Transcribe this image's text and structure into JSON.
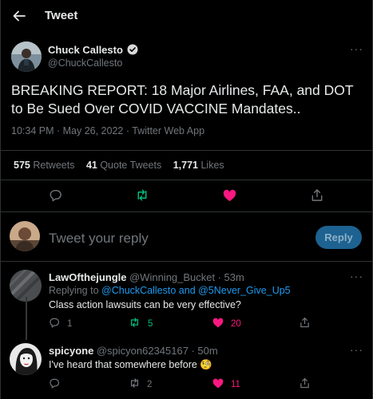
{
  "header": {
    "title": "Tweet"
  },
  "tweet": {
    "author_name": "Chuck Callesto",
    "author_handle": "@ChuckCallesto",
    "text": "BREAKING REPORT: 18 Major Airlines, FAA, and DOT to Be Sued Over COVID VACCINE Mandates..",
    "timestamp": "10:34 PM · May 26, 2022 · Twitter Web App",
    "stats": {
      "retweets_count": "575",
      "retweets_label": "Retweets",
      "quotes_count": "41",
      "quotes_label": "Quote Tweets",
      "likes_count": "1,771",
      "likes_label": "Likes"
    }
  },
  "composer": {
    "placeholder": "Tweet your reply",
    "button_label": "Reply"
  },
  "replies": [
    {
      "name": "LawOfthejungle",
      "handle": "@Winning_Bucket",
      "time": "· 53m",
      "replying_prefix": "Replying to",
      "replying_to": "@ChuckCallesto and @5Never_Give_Up5",
      "text": "Class action lawsuits can be very effective?",
      "reply_count": "1",
      "retweet_count": "5",
      "like_count": "20"
    },
    {
      "name": "spicyone",
      "handle": "@spicyon62345167",
      "time": "· 50m",
      "text": "I've heard that somewhere before",
      "emoji": "🧐",
      "reply_count": "",
      "retweet_count": "2",
      "like_count": "11"
    }
  ],
  "colors": {
    "accent": "#1d9bf0",
    "retweet": "#00ba7c",
    "like": "#f91880",
    "muted": "#71767b"
  },
  "icons": [
    "back-arrow-icon",
    "verified-badge-icon",
    "more-icon",
    "reply-icon",
    "retweet-icon",
    "like-icon",
    "share-icon"
  ]
}
